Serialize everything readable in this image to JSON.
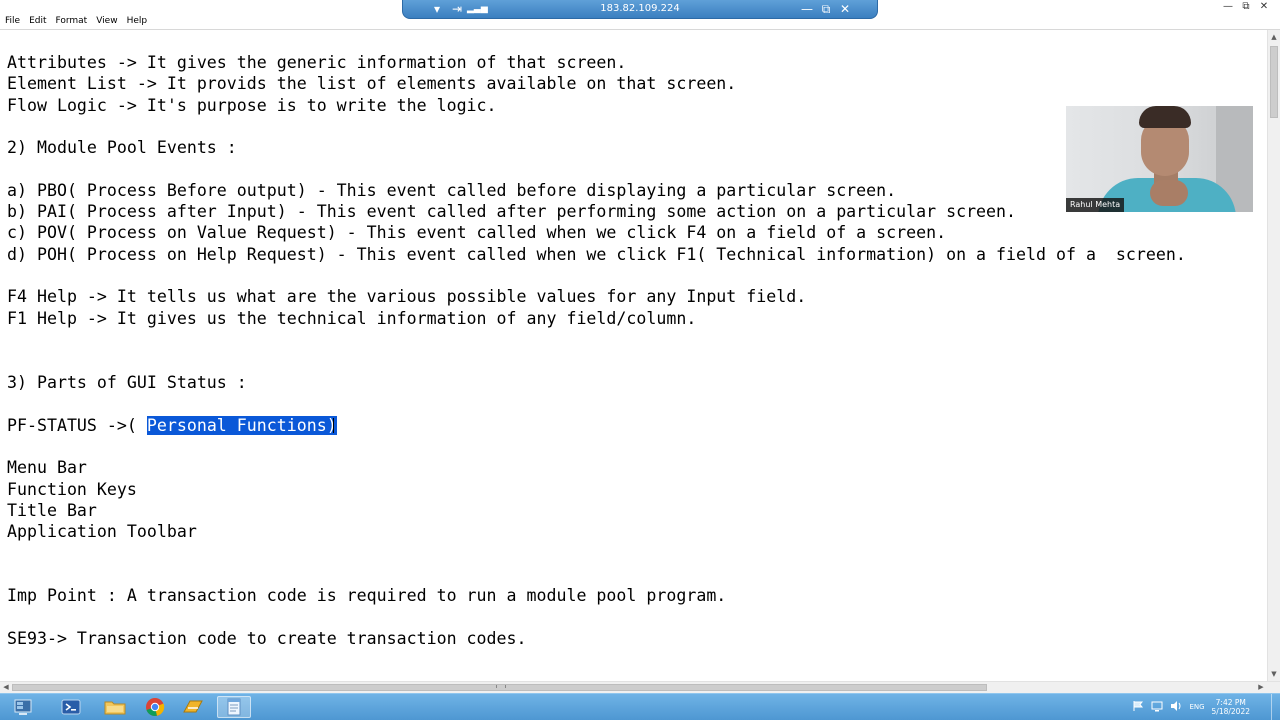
{
  "remote_bar": {
    "ip": "183.82.109.224",
    "pin_icon": "pin-icon",
    "signal_icon": "signal-icon"
  },
  "menu": {
    "items": [
      "File",
      "Edit",
      "Format",
      "View",
      "Help"
    ]
  },
  "document": {
    "lines": [
      {
        "text": "Attributes -> It gives the generic information of that screen."
      },
      {
        "text": "Element List -> It provids the list of elements available on that screen."
      },
      {
        "text": "Flow Logic -> It's purpose is to write the logic."
      },
      {
        "text": "2) Module Pool Events :"
      },
      {
        "text": "a) PBO( Process Before output) - This event called before displaying a particular screen."
      },
      {
        "text": "b) PAI( Process after Input) - This event called after performing some action on a particular screen."
      },
      {
        "text": "c) POV( Process on Value Request) - This event called when we click F4 on a field of a screen."
      },
      {
        "text": "d) POH( Process on Help Request) - This event called when we click F1( Technical information) on a field of a  screen."
      },
      {
        "text": "F4 Help -> It tells us what are the various possible values for any Input field."
      },
      {
        "text": "F1 Help -> It gives us the technical information of any field/column."
      },
      {
        "text": "3) Parts of GUI Status :"
      },
      {
        "text": "Menu Bar"
      },
      {
        "text": "Function Keys"
      },
      {
        "text": "Title Bar"
      },
      {
        "text": "Application Toolbar"
      },
      {
        "text": "Imp Point : A transaction code is required to run a module pool program."
      },
      {
        "text": "SE93-> Transaction code to create transaction codes."
      }
    ],
    "pf_status": {
      "prefix": "PF-STATUS ->( ",
      "selected": "Personal Functions)"
    }
  },
  "webcam": {
    "name": "Rahul Mehta"
  },
  "taskbar": {
    "apps": [
      "server-manager",
      "powershell",
      "file-explorer",
      "chrome",
      "sap-logon",
      "notepad"
    ],
    "tray": {
      "language": "ENG",
      "time": "7:42 PM",
      "date": "5/18/2022"
    }
  },
  "colors": {
    "selection": "#0a58d8",
    "taskbar": "#5aa3db",
    "rdp_bar": "#4a8dcc"
  }
}
